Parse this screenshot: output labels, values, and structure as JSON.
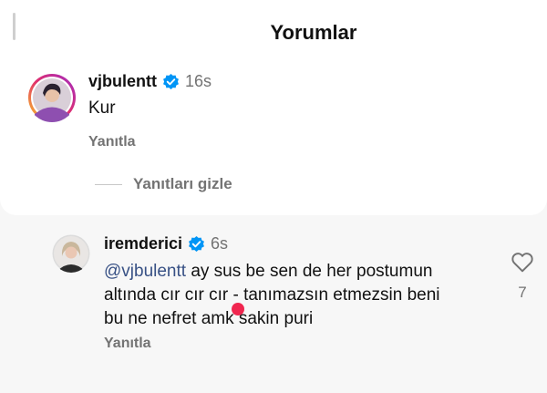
{
  "sheet": {
    "title": "Yorumlar"
  },
  "comments": [
    {
      "username": "vjbulentt",
      "time": "16s",
      "text": "Kur",
      "reply_label": "Yanıtla",
      "hide_replies_label": "Yanıtları gizle",
      "verified": true,
      "avatar_icon": "avatar-photo"
    },
    {
      "username": "iremderici",
      "time": "6s",
      "mention": "@vjbulentt",
      "text_line1": " ay sus be sen de her postumun",
      "text_line2": "altında cır cır cır - tanımazsın etmezsin beni",
      "text_line3": "bu ne nefret amk sakin puri",
      "reply_label": "Yanıtla",
      "likes": "7",
      "verified": true,
      "avatar_icon": "avatar-photo"
    }
  ],
  "colors": {
    "verified": "#0095f6",
    "mention": "#385185",
    "meta_text": "#737373",
    "red_dot": "#f0264f"
  },
  "icons": [
    "verified-badge-icon",
    "heart-outline-icon"
  ]
}
